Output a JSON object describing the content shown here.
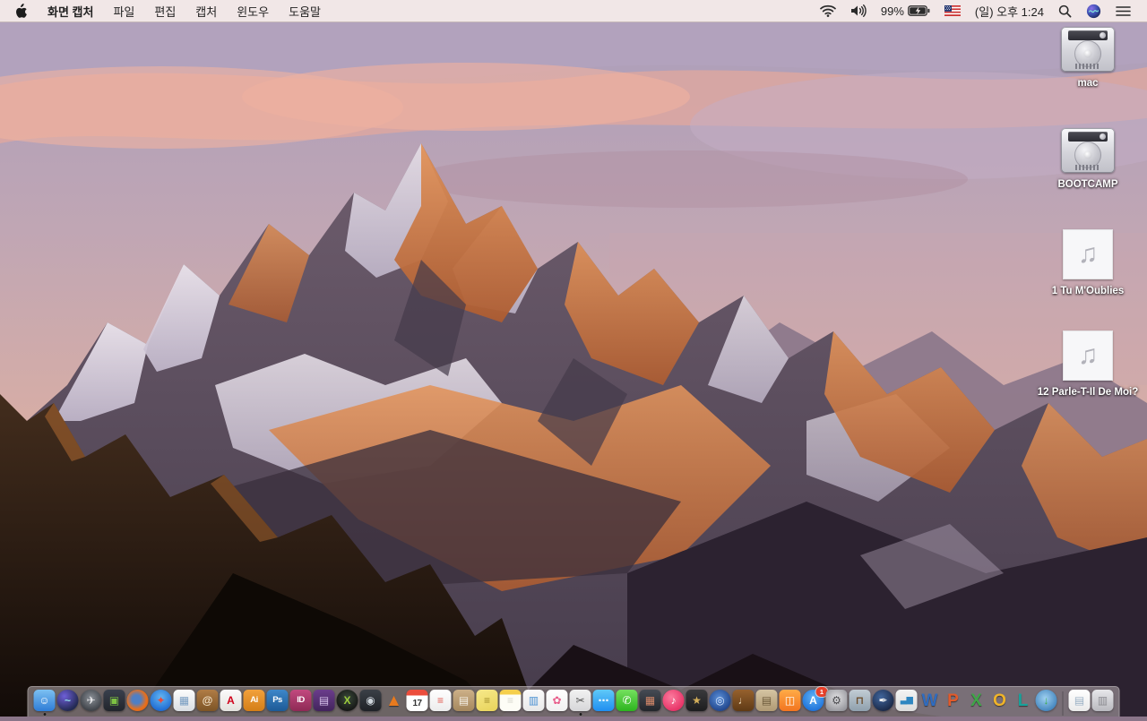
{
  "menu_bar": {
    "app_menus": [
      {
        "id": "app-name",
        "label": "화면 캡처",
        "bold": true
      },
      {
        "id": "file",
        "label": "파일"
      },
      {
        "id": "edit",
        "label": "편집"
      },
      {
        "id": "capture",
        "label": "캡처"
      },
      {
        "id": "window",
        "label": "윈도우"
      },
      {
        "id": "help",
        "label": "도움말"
      }
    ],
    "status": {
      "battery_percent": "99%",
      "clock": "(일) 오후 1:24",
      "icons": [
        "wifi-icon",
        "volume-icon",
        "battery-charging-icon",
        "us-flag-icon",
        "spotlight-icon",
        "siri-icon",
        "notification-center-icon"
      ]
    }
  },
  "desktop": {
    "icons": [
      {
        "id": "mac",
        "kind": "hard-drive",
        "label": "mac"
      },
      {
        "id": "bootcamp",
        "kind": "hard-drive",
        "label": "BOOTCAMP"
      },
      {
        "id": "tu-moublies",
        "kind": "audio-file",
        "label": "1 Tu M'Oublies"
      },
      {
        "id": "parle-t-il-de-moi",
        "kind": "audio-file",
        "label": "12 Parle-T-Il De Moi?"
      }
    ]
  },
  "dock": {
    "items": [
      {
        "id": "finder",
        "title": "Finder",
        "shape": "rounded",
        "bg": "linear-gradient(180deg,#7cc0f2,#2e7cd6)",
        "fg": "#ffffff",
        "glyph": "☺",
        "running": true
      },
      {
        "id": "siri",
        "title": "Siri",
        "shape": "circle",
        "bg": "radial-gradient(circle at 35% 30%,#6e5fd8,#232a52 72%)",
        "fg": "#8fe0e8",
        "glyph": "~"
      },
      {
        "id": "launchpad",
        "title": "Launchpad",
        "shape": "circle",
        "bg": "radial-gradient(circle at 50% 40%,#8a8f96,#3a3e44 78%)",
        "fg": "#e8e8ea",
        "glyph": "✈"
      },
      {
        "id": "mission-control",
        "title": "Mission Control",
        "shape": "rounded",
        "bg": "linear-gradient(180deg,#39404d,#22252c)",
        "fg": "#7dc243",
        "glyph": "▣"
      },
      {
        "id": "firefox",
        "title": "Firefox",
        "shape": "circle",
        "bg": "radial-gradient(circle at 45% 45%,#4f7fc4 26%,#e8701c 60%,#c9520e)",
        "fg": "#ffffff",
        "glyph": ""
      },
      {
        "id": "safari",
        "title": "Safari",
        "shape": "circle",
        "bg": "radial-gradient(circle at 50% 35%,#63b5f2,#1a66cf 82%)",
        "fg": "#e94b3c",
        "glyph": "✦"
      },
      {
        "id": "preview",
        "title": "Preview",
        "shape": "rounded",
        "bg": "linear-gradient(180deg,#fdfdfd,#d9dde2)",
        "fg": "#7a9ec2",
        "glyph": "▦"
      },
      {
        "id": "contacts",
        "title": "Contacts",
        "shape": "rounded",
        "bg": "linear-gradient(180deg,#b07c45,#7d5426)",
        "fg": "#f2e2c8",
        "glyph": "@"
      },
      {
        "id": "acrobat-reader",
        "title": "Adobe Acrobat Reader",
        "shape": "rounded",
        "bg": "linear-gradient(180deg,#fbfbfb,#e4e2de)",
        "fg": "#d0021b",
        "glyph": "A"
      },
      {
        "id": "illustrator",
        "title": "Adobe Illustrator",
        "shape": "rounded",
        "bg": "linear-gradient(180deg,#f2a13c,#d47e17)",
        "fg": "#ffffff",
        "glyph": "Ai"
      },
      {
        "id": "photoshop",
        "title": "Adobe Photoshop",
        "shape": "rounded",
        "bg": "linear-gradient(180deg,#3d87c9,#1d5a96)",
        "fg": "#ffffff",
        "glyph": "Ps"
      },
      {
        "id": "indesign",
        "title": "Adobe InDesign",
        "shape": "rounded",
        "bg": "linear-gradient(180deg,#c2497f,#8e2a55)",
        "fg": "#ffffff",
        "glyph": "ID"
      },
      {
        "id": "toast",
        "title": "Toast Titanium",
        "shape": "rounded",
        "bg": "linear-gradient(180deg,#6b3d8c,#42245c)",
        "fg": "#d8c2ec",
        "glyph": "▤"
      },
      {
        "id": "xld",
        "title": "X Photo App",
        "shape": "circle",
        "bg": "radial-gradient(circle at 50% 40%,#3a4a3a,#141414 78%)",
        "fg": "#9ccc3c",
        "glyph": "X"
      },
      {
        "id": "disk-tool",
        "title": "Disk Tool",
        "shape": "rounded",
        "bg": "linear-gradient(180deg,#3b4047,#1f2227)",
        "fg": "#cfd6dd",
        "glyph": "◉"
      },
      {
        "id": "vlc",
        "title": "VLC",
        "shape": "bare",
        "fg": "#e87a1e",
        "glyph": "▲"
      },
      {
        "id": "calendar",
        "title": "Calendar",
        "shape": "rounded",
        "cls": "cal",
        "bg": "linear-gradient(180deg,#ec4d3c 0%,#ec4d3c 27%,#ffffff 27%)",
        "fg": "#333333",
        "glyph": "17"
      },
      {
        "id": "reminders",
        "title": "Reminders",
        "shape": "rounded",
        "bg": "linear-gradient(180deg,#ffffff,#ececec)",
        "fg": "#e05a4f",
        "glyph": "≡"
      },
      {
        "id": "archive-utility",
        "title": "Archive Utility",
        "shape": "rounded",
        "bg": "linear-gradient(180deg,#cdb088,#a5885e)",
        "fg": "#f5f0e6",
        "glyph": "▤"
      },
      {
        "id": "stickies",
        "title": "Stickies",
        "shape": "rounded",
        "bg": "linear-gradient(160deg,#f7e98a,#e8d35a)",
        "fg": "#a08c2a",
        "glyph": "≡"
      },
      {
        "id": "notes",
        "title": "Notes",
        "shape": "rounded",
        "bg": "linear-gradient(180deg,#f5cf4c 0%,#f5cf4c 22%,#fdfdf6 22%)",
        "fg": "#d8d8cf",
        "glyph": "≡"
      },
      {
        "id": "documents-app",
        "title": "Documents App",
        "shape": "rounded",
        "bg": "linear-gradient(180deg,#fbfbfb,#e8e8e8)",
        "fg": "#4a90d2",
        "glyph": "▥"
      },
      {
        "id": "photos",
        "title": "Photos",
        "shape": "rounded",
        "bg": "linear-gradient(180deg,#ffffff,#f0f0f0)",
        "fg": "#e85d8a",
        "glyph": "✿"
      },
      {
        "id": "grab",
        "title": "화면 캡처 (Grab)",
        "shape": "rounded",
        "bg": "linear-gradient(180deg,#f2f2f2,#d6d6d8)",
        "fg": "#555555",
        "glyph": "✂",
        "running": true
      },
      {
        "id": "messages",
        "title": "Messages",
        "shape": "rounded",
        "bg": "linear-gradient(180deg,#5fc9f8,#1f8ef0)",
        "fg": "#ffffff",
        "glyph": "⋯"
      },
      {
        "id": "facetime",
        "title": "FaceTime",
        "shape": "rounded",
        "bg": "linear-gradient(180deg,#74e05e,#2cb41e)",
        "fg": "#ffffff",
        "glyph": "✆"
      },
      {
        "id": "photo-booth",
        "title": "Photo Booth",
        "shape": "rounded",
        "bg": "linear-gradient(180deg,#454b54,#23262b)",
        "fg": "#d88a6a",
        "glyph": "▦"
      },
      {
        "id": "itunes",
        "title": "iTunes",
        "shape": "circle",
        "bg": "radial-gradient(circle at 40% 35%,#fb7a9d,#e62e63 78%)",
        "fg": "#ffffff",
        "glyph": "♪"
      },
      {
        "id": "imovie",
        "title": "iMovie",
        "shape": "rounded",
        "bg": "linear-gradient(180deg,#3a3a3c,#1d1d1f)",
        "fg": "#d4af5a",
        "glyph": "★"
      },
      {
        "id": "idvd",
        "title": "iDVD",
        "shape": "circle",
        "bg": "radial-gradient(circle at 45% 40%,#5a8fd8,#1c3f85 80%)",
        "fg": "#d6e4fb",
        "glyph": "◎"
      },
      {
        "id": "garageband",
        "title": "GarageBand",
        "shape": "rounded",
        "bg": "linear-gradient(180deg,#96612e,#5f3a16)",
        "fg": "#f0ddba",
        "glyph": "♩"
      },
      {
        "id": "media-kit",
        "title": "Press Kit",
        "shape": "rounded",
        "bg": "linear-gradient(180deg,#d5c4a2,#b09a74)",
        "fg": "#6d5a3a",
        "glyph": "▤"
      },
      {
        "id": "ibooks",
        "title": "iBooks",
        "shape": "rounded",
        "bg": "linear-gradient(180deg,#ffab47,#f2741f)",
        "fg": "#ffffff",
        "glyph": "◫"
      },
      {
        "id": "app-store",
        "title": "App Store",
        "shape": "circle",
        "bg": "radial-gradient(circle at 50% 35%,#5fb1f5,#1a6fd8 82%)",
        "fg": "#ffffff",
        "glyph": "A",
        "badge": "1"
      },
      {
        "id": "system-preferences",
        "title": "System Preferences",
        "shape": "rounded",
        "bg": "radial-gradient(circle at 50% 40%,#e2e2e4,#96969c 82%)",
        "fg": "#4a4a4e",
        "glyph": "⚙"
      },
      {
        "id": "keynote",
        "title": "Keynote",
        "shape": "rounded",
        "bg": "linear-gradient(180deg,#c2ccd4,#8fa0ad)",
        "fg": "#6d4f2f",
        "glyph": "⊓"
      },
      {
        "id": "pages",
        "title": "Pages",
        "shape": "circle",
        "bg": "radial-gradient(circle at 40% 35%,#40659c,#17233f 82%)",
        "fg": "#f2f2f2",
        "glyph": "✒"
      },
      {
        "id": "numbers",
        "title": "Numbers",
        "shape": "rounded",
        "bg": "linear-gradient(180deg,#f4f4f4,#dcdcdc)",
        "fg": "#2e86c1",
        "glyph": "▃▆"
      },
      {
        "id": "word",
        "title": "Microsoft Word",
        "shape": "bare",
        "fg": "#2f6cc0",
        "glyph": "W"
      },
      {
        "id": "powerpoint",
        "title": "Microsoft PowerPoint",
        "shape": "bare",
        "fg": "#e05a2b",
        "glyph": "P"
      },
      {
        "id": "excel",
        "title": "Microsoft Excel",
        "shape": "bare",
        "fg": "#3fa548",
        "glyph": "X"
      },
      {
        "id": "outlook",
        "title": "Microsoft Outlook",
        "shape": "bare",
        "fg": "#f0b429",
        "glyph": "O"
      },
      {
        "id": "lync",
        "title": "Microsoft Lync",
        "shape": "bare",
        "fg": "#18a39b",
        "glyph": "L"
      },
      {
        "id": "download-manager",
        "title": "Download Manager",
        "shape": "circle",
        "bg": "radial-gradient(circle at 45% 40%,#9ed0f0,#3a7db8 82%)",
        "fg": "#3fae4a",
        "glyph": "↓"
      },
      {
        "kind": "divider"
      },
      {
        "id": "document-file",
        "title": "Document File",
        "shape": "rounded",
        "bg": "linear-gradient(180deg,#ffffff,#eaeaea)",
        "fg": "#9ab0c4",
        "glyph": "▤"
      },
      {
        "id": "trash",
        "title": "Trash (Full)",
        "shape": "rounded",
        "bg": "linear-gradient(180deg,#e7e7ea,#b9b9bf)",
        "fg": "#8a8a90",
        "glyph": "▥"
      }
    ]
  },
  "wallpaper_palette": {
    "sky_top": "#a99dbb",
    "sky_pink": "#e6a89b",
    "lit_rock": "#e09055",
    "shadow_rock": "#5f5166",
    "snow": "#eee6ee",
    "foreground_rock": "#1c120c"
  }
}
